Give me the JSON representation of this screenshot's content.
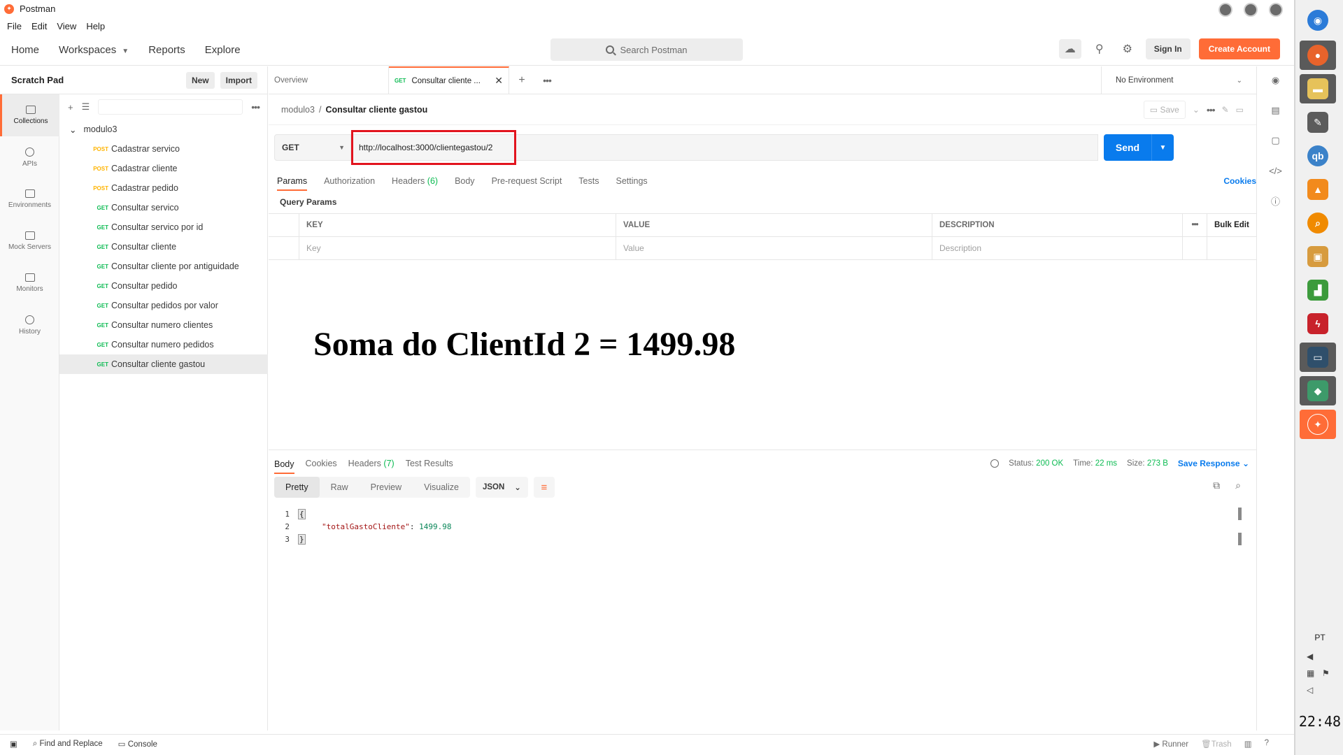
{
  "window": {
    "title": "Postman"
  },
  "menu": [
    "File",
    "Edit",
    "View",
    "Help"
  ],
  "header": {
    "nav": {
      "home": "Home",
      "workspaces": "Workspaces",
      "reports": "Reports",
      "explore": "Explore"
    },
    "search_placeholder": "Search Postman",
    "sign_in": "Sign In",
    "create_account": "Create Account"
  },
  "sidebar": {
    "title": "Scratch Pad",
    "new_label": "New",
    "import_label": "Import",
    "rail": [
      "Collections",
      "APIs",
      "Environments",
      "Mock Servers",
      "Monitors",
      "History"
    ],
    "folder": "modulo3",
    "items": [
      {
        "method": "POST",
        "name": "Cadastrar servico"
      },
      {
        "method": "POST",
        "name": "Cadastrar cliente"
      },
      {
        "method": "POST",
        "name": "Cadastrar pedido"
      },
      {
        "method": "GET",
        "name": "Consultar servico"
      },
      {
        "method": "GET",
        "name": "Consultar servico por id"
      },
      {
        "method": "GET",
        "name": "Consultar cliente"
      },
      {
        "method": "GET",
        "name": "Consultar cliente por antiguidade"
      },
      {
        "method": "GET",
        "name": "Consultar pedido"
      },
      {
        "method": "GET",
        "name": "Consultar pedidos por valor"
      },
      {
        "method": "GET",
        "name": "Consultar numero clientes"
      },
      {
        "method": "GET",
        "name": "Consultar numero pedidos"
      },
      {
        "method": "GET",
        "name": "Consultar cliente gastou"
      }
    ]
  },
  "tabs": {
    "overview": "Overview",
    "active_method": "GET",
    "active_title": "Consultar cliente ...",
    "environment": "No Environment"
  },
  "request": {
    "breadcrumb_parent": "modulo3",
    "breadcrumb_sep": "/",
    "breadcrumb_current": "Consultar cliente gastou",
    "save_label": "Save",
    "method": "GET",
    "url": "http://localhost:3000/clientegastou/2",
    "send_label": "Send",
    "tabs": {
      "params": "Params",
      "authorization": "Authorization",
      "headers": "Headers",
      "headers_count": "(6)",
      "body": "Body",
      "pre_request": "Pre-request Script",
      "tests": "Tests",
      "settings": "Settings",
      "cookies": "Cookies"
    },
    "query_params_title": "Query Params",
    "table": {
      "headers": {
        "key": "KEY",
        "value": "VALUE",
        "description": "DESCRIPTION",
        "bulk_edit": "Bulk Edit"
      },
      "placeholders": {
        "key": "Key",
        "value": "Value",
        "description": "Description"
      }
    }
  },
  "annotation": "Soma do ClientId 2 = 1499.98",
  "response": {
    "tabs": {
      "body": "Body",
      "cookies": "Cookies",
      "headers": "Headers",
      "headers_count": "(7)",
      "test_results": "Test Results"
    },
    "status_label": "Status:",
    "status_value": "200 OK",
    "time_label": "Time:",
    "time_value": "22 ms",
    "size_label": "Size:",
    "size_value": "273 B",
    "save_response": "Save Response",
    "view_modes": [
      "Pretty",
      "Raw",
      "Preview",
      "Visualize"
    ],
    "format": "JSON",
    "code": {
      "line_numbers": [
        "1",
        "2",
        "3"
      ],
      "open_brace": "{",
      "key": "\"totalGastoCliente\"",
      "colon": ": ",
      "value": "1499.98",
      "close_brace": "}"
    }
  },
  "statusbar": {
    "find_replace": "Find and Replace",
    "console": "Console",
    "runner": "Runner",
    "trash": "Trash"
  },
  "taskbar": {
    "language": "PT",
    "time": "22:48"
  },
  "colors": {
    "accent": "#ff6c37",
    "send": "#097bed",
    "get": "#0cbb52",
    "post": "#ffb400",
    "highlight": "#e2141e"
  }
}
